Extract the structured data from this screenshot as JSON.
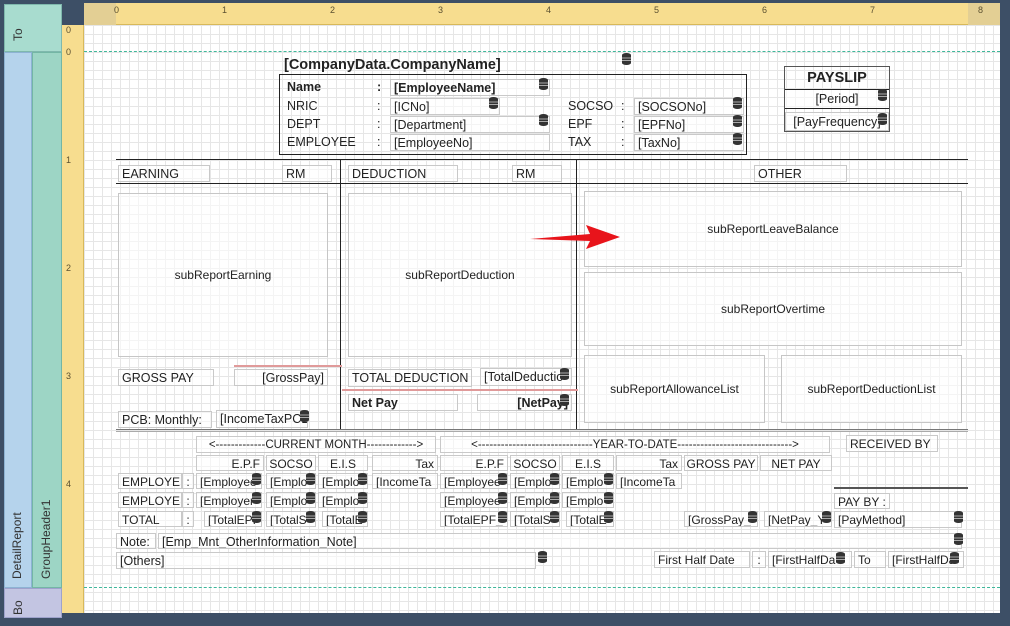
{
  "bands": {
    "top": "To",
    "detail": "DetailReport",
    "group": "GroupHeader1",
    "bottom": "Bo"
  },
  "ruler": {
    "horizontal": [
      "0",
      "1",
      "2",
      "3",
      "4",
      "5",
      "6",
      "7",
      "8"
    ],
    "vertical": [
      "0",
      "0",
      "1",
      "2",
      "3",
      "4"
    ]
  },
  "header": {
    "company": "[CompanyData.CompanyName]",
    "name_label": "Name",
    "nric_label": "NRIC",
    "dept_label": "DEPT",
    "employee_label": "EMPLOYEE",
    "colon": ":",
    "name_value": "[EmployeeName]",
    "nric_value": "[ICNo]",
    "dept_value": "[Department]",
    "employee_value": "[EmployeeNo]",
    "socso_label": "SOCSO",
    "epf_label": "EPF",
    "tax_label": "TAX",
    "socso_value": "[SOCSONo]",
    "epf_value": "[EPFNo]",
    "tax_value": "[TaxNo]",
    "payslip_title": "PAYSLIP",
    "period": "[Period]",
    "pay_frequency": "[PayFrequency]"
  },
  "sections": {
    "earning": "EARNING",
    "rm": "RM",
    "deduction": "DEDUCTION",
    "other": "OTHER"
  },
  "subreports": {
    "earning": "subReportEarning",
    "deduction": "subReportDeduction",
    "leave_balance": "subReportLeaveBalance",
    "overtime": "subReportOvertime",
    "allowance_list": "subReportAllowanceList",
    "deduction_list": "subReportDeductionList"
  },
  "totals": {
    "gross_pay_label": "GROSS PAY",
    "gross_pay_value": "[GrossPay]",
    "total_deduction_label": "TOTAL DEDUCTION",
    "total_deduction_value": "[TotalDeductio",
    "net_pay_label": "Net Pay",
    "net_pay_value": "[NetPay]",
    "pcb_label": "PCB: Monthly:",
    "pcb_value": "[IncomeTaxPCB"
  },
  "contrib": {
    "current_month": "<-------------CURRENT MONTH------------->",
    "year_to_date": "<------------------------------YEAR-TO-DATE------------------------------>",
    "received_by": "RECEIVED BY",
    "col_epf": "E.P.F",
    "col_socso": "SOCSO",
    "col_eis": "E.I.S",
    "col_tax": "Tax",
    "col_gross": "GROSS PAY",
    "col_net": "NET PAY",
    "row_employee": "EMPLOYEE",
    "row_employer": "EMPLOYER",
    "row_total": "TOTAL",
    "colon": ":",
    "emp_epf": "[Employee",
    "emp_socso": "[Emplo",
    "emp_eis": "[Emplo",
    "emp_tax": "[IncomeTa",
    "er_epf": "[Employer",
    "er_socso": "[Emplo",
    "er_eis": "[Emplo",
    "tot_epf": "[TotalEPF",
    "tot_socso": "[TotalS",
    "tot_eis": "[TotalE",
    "ytd_emp_epf": "[Employee",
    "ytd_emp_socso": "[Emplo",
    "ytd_emp_eis": "[Emplo",
    "ytd_emp_tax": "[IncomeTa",
    "ytd_er_epf": "[Employee",
    "ytd_er_socso": "[Emplo",
    "ytd_er_eis": "[Emplo",
    "ytd_tot_epf": "[TotalEPF_",
    "ytd_tot_socso": "[TotalS",
    "ytd_tot_eis": "[TotalE",
    "ytd_gross": "[GrossPay_",
    "ytd_net": "[NetPay_Y",
    "pay_by_label": "PAY BY :",
    "pay_method": "[PayMethod]"
  },
  "footer": {
    "note_label": "Note:",
    "note_value": "[Emp_Mnt_OtherInformation_Note]",
    "others": "[Others]",
    "first_half_label": "First Half Date",
    "colon": ":",
    "first_half_from": "[FirstHalfDa",
    "to_label": "To",
    "first_half_to": "[FirstHalfDa"
  },
  "colors": {
    "band_top": "#a8dccf",
    "band_detail": "#b5d3ec",
    "band_group": "#9dd5c5",
    "ruler": "#f7dd8f",
    "arrow": "#e8141b"
  }
}
